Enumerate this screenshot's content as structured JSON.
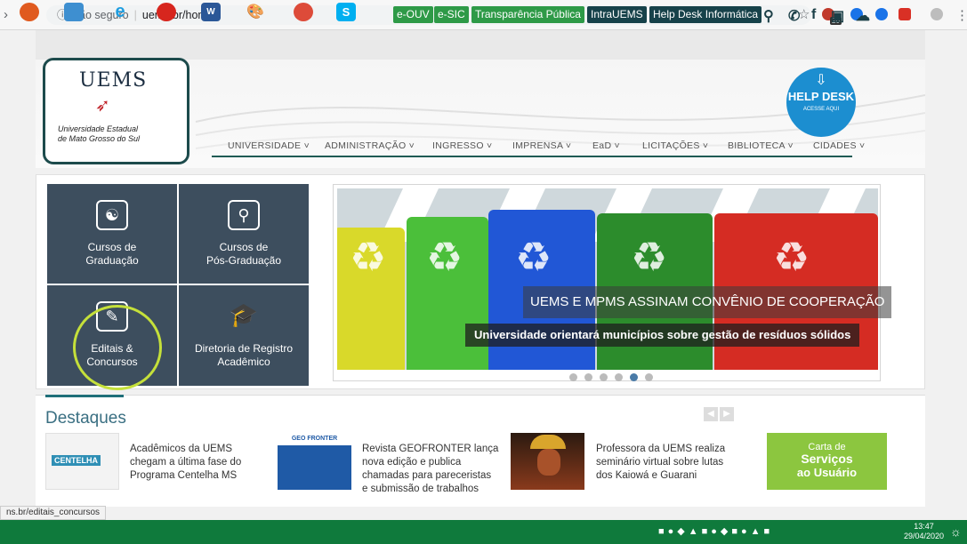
{
  "browser": {
    "back": "›",
    "reload": "C",
    "info_icon": "ⓘ",
    "security": "Não seguro",
    "url": "uems.br/home",
    "star": "☆",
    "extension_badge": "20"
  },
  "top_links": [
    "e-OUV",
    "e-SIC",
    "Transparência Pública",
    "IntraUEMS",
    "Help Desk Informática"
  ],
  "social_icons": [
    "search-icon",
    "phone-icon",
    "facebook-icon",
    "instagram-icon",
    "soundcloud-icon"
  ],
  "logo": {
    "name": "UEMS",
    "subtitle_1": "Universidade Estadual",
    "subtitle_2": "de Mato Grosso do Sul"
  },
  "menu": [
    "UNIVERSIDADE ˅",
    "ADMINISTRAÇÃO ˅",
    "INGRESSO ˅",
    "IMPRENSA ˅",
    "EaD ˅",
    "LICITAÇÕES ˅",
    "BIBLIOTECA ˅",
    "CIDADES ˅"
  ],
  "help_desk": {
    "title": "HELP DESK",
    "subtitle": "ACESSE AQUI"
  },
  "tiles": [
    {
      "line1": "Cursos de",
      "line2": "Graduação",
      "icon": "graduate-icon"
    },
    {
      "line1": "Cursos de",
      "line2": "Pós-Graduação",
      "icon": "book-search-icon"
    },
    {
      "line1": "Editais &",
      "line2": "Concursos",
      "icon": "edit-document-icon"
    },
    {
      "line1": "Diretoria de Registro",
      "line2": "Acadêmico",
      "icon": "graduation-cap-icon"
    }
  ],
  "slider": {
    "caption_title": "UEMS E MPMS ASSINAM CONVÊNIO DE COOPERAÇÃO",
    "caption_sub": "Universidade orientará municípios sobre gestão de resíduos sólidos",
    "dots_total": 6,
    "active_dot": 5
  },
  "destaques": {
    "title": "Destaques",
    "items": [
      {
        "thumb_text": "CENTELHA",
        "text_1": "Acadêmicos da UEMS",
        "text_2": "chegam a última fase do",
        "text_3": "Programa Centelha MS",
        "text_4": ""
      },
      {
        "thumb_text": "GEO FRONTER",
        "text_1": "Revista GEOFRONTER lança",
        "text_2": "nova edição e publica",
        "text_3": "chamadas para pareceristas",
        "text_4": "e submissão de trabalhos"
      },
      {
        "thumb_text": "",
        "text_1": "Professora da UEMS realiza",
        "text_2": "seminário virtual sobre lutas",
        "text_3": "dos Kaiowá e Guarani",
        "text_4": ""
      },
      {
        "thumb_text_1": "Carta de",
        "thumb_text_2": "Serviços",
        "thumb_text_3": "ao Usuário"
      }
    ]
  },
  "status_url": "ns.br/editais_concursos",
  "taskbar": {
    "time": "13:47",
    "date": "29/04/2020"
  },
  "colors": {
    "tile_bg": "#3d4e5e",
    "accent_green": "#2e9a47",
    "dark_teal": "#17424a",
    "highlight_circle": "#c5e03a",
    "taskbar": "#0f7a3c"
  }
}
